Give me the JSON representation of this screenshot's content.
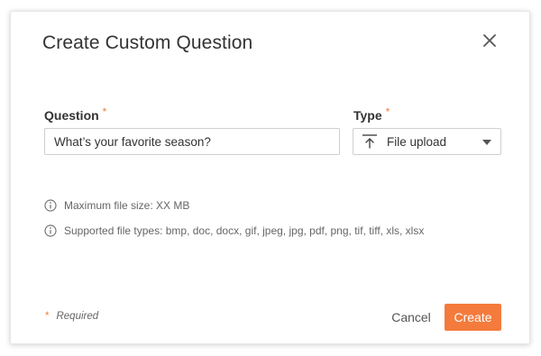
{
  "dialog": {
    "title": "Create Custom Question",
    "close_icon": "close-icon"
  },
  "form": {
    "question": {
      "label": "Question",
      "required_marker": "*",
      "value": "What’s your favorite season?"
    },
    "type": {
      "label": "Type",
      "required_marker": "*",
      "selected": "File upload",
      "icon": "upload-icon",
      "dropdown_icon": "caret-down-icon"
    }
  },
  "info": [
    {
      "icon": "info-icon",
      "text": "Maximum file size: XX MB"
    },
    {
      "icon": "info-icon",
      "text": "Supported file types: bmp, doc, docx, gif, jpeg, jpg, pdf, png, tif, tiff, xls, xlsx"
    }
  ],
  "footer": {
    "required_marker": "*",
    "required_text": "Required",
    "cancel_label": "Cancel",
    "create_label": "Create"
  },
  "colors": {
    "accent": "#f47b3c",
    "text": "#333333",
    "muted": "#666666",
    "border": "#cfcfcf"
  }
}
